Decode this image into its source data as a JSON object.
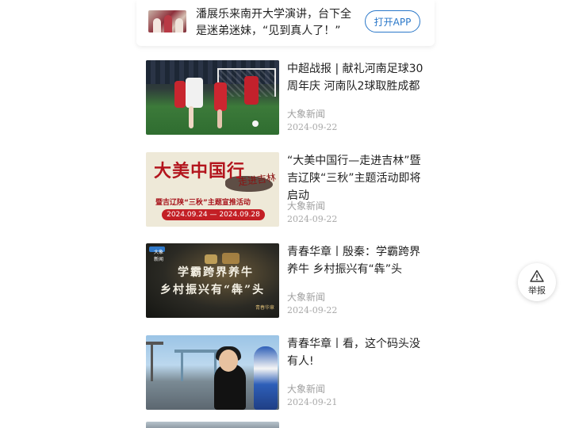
{
  "banner": {
    "text": "潘展乐来南开大学演讲，台下全是迷弟迷妹，“见到真人了！”",
    "open_app_label": "打开APP"
  },
  "news": [
    {
      "title": "中超战报 | 献礼河南足球30周年庆 河南队2球取胜成都",
      "source": "大象新闻",
      "date": "2024-09-22"
    },
    {
      "title": "“大美中国行—走进吉林”暨吉辽陕“三秋”主题活动即将启动",
      "source": "大象新闻",
      "date": "2024-09-22",
      "thumb_text": {
        "main": "大美中国行",
        "side": "走进吉林",
        "sub": "暨吉辽陕“三秋”主题宣推活动",
        "dates": "2024.09.24 — 2024.09.28"
      }
    },
    {
      "title": "青春华章丨殷秦：学霸跨界养牛 乡村振兴有“犇”头",
      "source": "大象新闻",
      "date": "2024-09-22",
      "thumb_text": {
        "logo": "大象新闻",
        "line1": "学霸跨界养牛",
        "line2": "乡村振兴有“犇”头",
        "tag": "青春华章"
      }
    },
    {
      "title": "青春华章丨看，这个码头没有人!",
      "source": "大象新闻",
      "date": "2024-09-21"
    }
  ],
  "report": {
    "label": "举报",
    "icon": "warning-triangle-icon"
  }
}
